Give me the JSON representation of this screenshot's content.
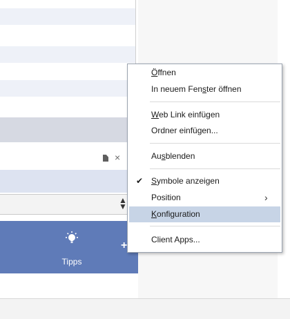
{
  "tipps": {
    "label": "Tipps"
  },
  "menu": {
    "items": [
      {
        "label": "Öffnen",
        "underline_index": 0
      },
      {
        "label": "In neuem Fenster öffnen",
        "underline_index": 12
      },
      {
        "label": "Web Link einfügen",
        "underline_index": 0
      },
      {
        "label": "Ordner einfügen...",
        "underline_index": -1
      },
      {
        "label": "Ausblenden",
        "underline_index": 2
      },
      {
        "label": "Symbole anzeigen",
        "underline_index": 0,
        "checked": true
      },
      {
        "label": "Position",
        "underline_index": -1,
        "submenu": true
      },
      {
        "label": "Konfiguration",
        "underline_index": 0,
        "highlighted": true
      },
      {
        "label": "Client Apps...",
        "underline_index": -1
      }
    ],
    "check_glyph": "✔",
    "chevron_glyph": "›"
  },
  "colors": {
    "tipps_bar": "#5f7bb8",
    "menu_highlight": "#c7d4e6"
  }
}
